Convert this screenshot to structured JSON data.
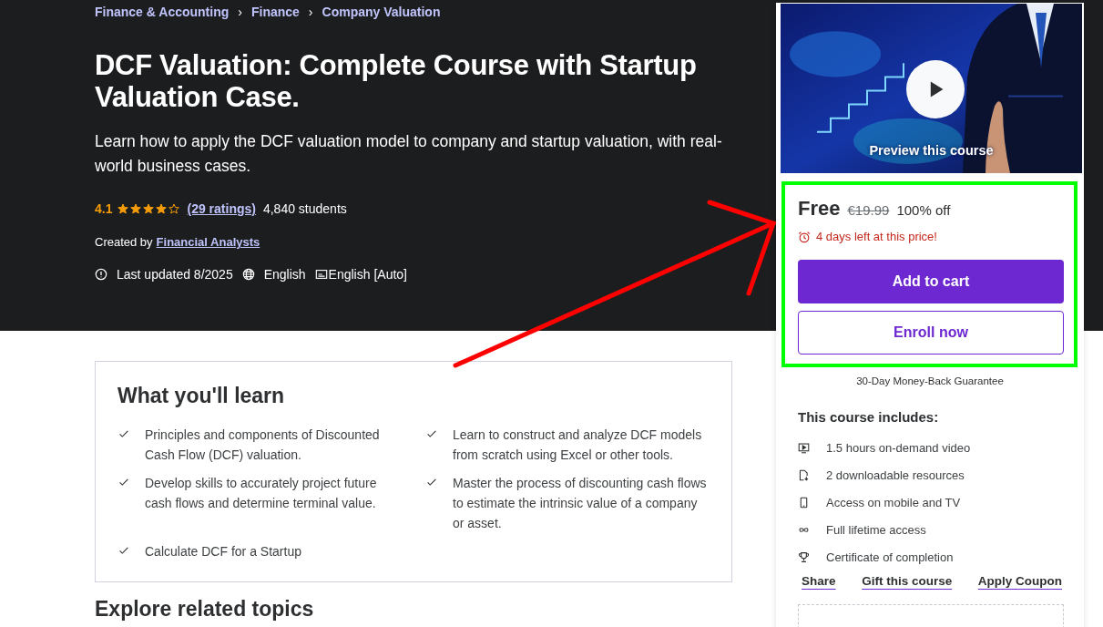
{
  "breadcrumb": [
    {
      "label": "Finance & Accounting"
    },
    {
      "label": "Finance"
    },
    {
      "label": "Company Valuation"
    }
  ],
  "separator": "›",
  "title": "DCF Valuation: Complete Course with Startup Valuation Case.",
  "subtitle": "Learn how to apply the DCF valuation model to company and startup valuation, with real-world business cases.",
  "rating": {
    "score": "4.1",
    "stars": 4,
    "ratings_link": "(29 ratings)",
    "students": "4,840 students"
  },
  "created_by": {
    "label": "Created by",
    "author": "Financial Analysts"
  },
  "meta": {
    "last_updated": "Last updated 8/2025",
    "language": "English",
    "captions": "English [Auto]"
  },
  "learn": {
    "heading": "What you'll learn",
    "items": [
      {
        "text": "Principles and components of Discounted Cash Flow (DCF) valuation."
      },
      {
        "text": "Learn to construct and analyze DCF models from scratch using Excel or other tools."
      },
      {
        "text": "Develop skills to accurately project future cash flows and determine terminal value."
      },
      {
        "text": "Master the process of discounting cash flows to estimate the intrinsic value of a company or asset."
      },
      {
        "text": "Calculate DCF for a Startup"
      }
    ]
  },
  "related_heading": "Explore related topics",
  "sidebar": {
    "preview_label": "Preview this course",
    "price": "Free",
    "original_price": "€19.99",
    "discount": "100% off",
    "deadline": "4 days left at this price!",
    "buttons": [
      {
        "label": "Add to cart",
        "kind": "primary"
      },
      {
        "label": "Enroll now",
        "kind": "outline"
      }
    ],
    "guarantee": "30-Day Money-Back Guarantee",
    "includes_heading": "This course includes:",
    "includes": [
      {
        "kind": "video",
        "text": "1.5 hours on-demand video"
      },
      {
        "kind": "file",
        "text": "2 downloadable resources"
      },
      {
        "kind": "mobile",
        "text": "Access on mobile and TV"
      },
      {
        "kind": "infinity",
        "text": "Full lifetime access"
      },
      {
        "kind": "trophy",
        "text": "Certificate of completion"
      }
    ],
    "links": [
      {
        "label": "Share"
      },
      {
        "label": "Gift this course"
      },
      {
        "label": "Apply Coupon"
      }
    ]
  }
}
